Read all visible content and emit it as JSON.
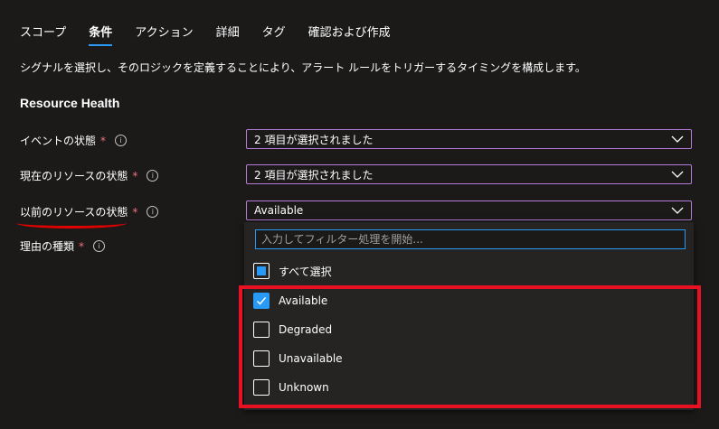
{
  "tabs": [
    {
      "label": "スコープ",
      "active": false
    },
    {
      "label": "条件",
      "active": true
    },
    {
      "label": "アクション",
      "active": false
    },
    {
      "label": "詳細",
      "active": false
    },
    {
      "label": "タグ",
      "active": false
    },
    {
      "label": "確認および作成",
      "active": false
    }
  ],
  "description": "シグナルを選択し、そのロジックを定義することにより、アラート ルールをトリガーするタイミングを構成します。",
  "section_title": "Resource Health",
  "fields": [
    {
      "label": "イベントの状態",
      "required_mark": "*",
      "info": "i",
      "value": "2 項目が選択されました"
    },
    {
      "label": "現在のリソースの状態",
      "required_mark": "*",
      "info": "i",
      "value": "2 項目が選択されました"
    },
    {
      "label": "以前のリソースの状態",
      "required_mark": "*",
      "info": "i",
      "value": "Available"
    },
    {
      "label": "理由の種類",
      "required_mark": "*",
      "info": "i"
    }
  ],
  "dropdown_panel": {
    "filter_placeholder": "入力してフィルター処理を開始...",
    "select_all_label": "すべて選択",
    "options": [
      {
        "label": "Available",
        "checked": true
      },
      {
        "label": "Degraded",
        "checked": false
      },
      {
        "label": "Unavailable",
        "checked": false
      },
      {
        "label": "Unknown",
        "checked": false
      }
    ]
  },
  "colors": {
    "background": "#1b1a19",
    "accent": "#2899f5",
    "dropdown_border": "#b47cd8",
    "required": "#f1707b",
    "highlight": "#e81123"
  }
}
